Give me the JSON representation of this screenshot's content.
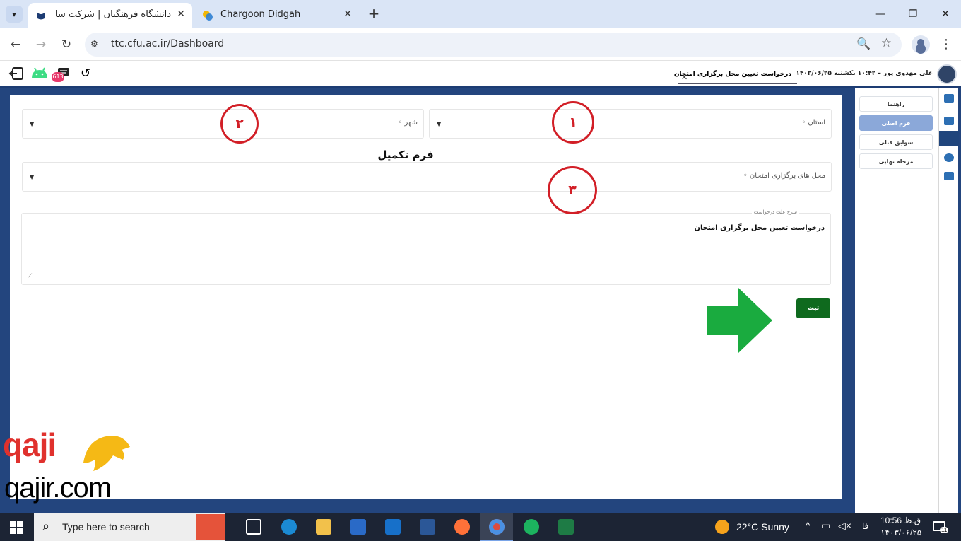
{
  "browser": {
    "tabs": [
      {
        "title": "دانشگاه فرهنگیان | شرکت سامانه",
        "active": true
      },
      {
        "title": "Chargoon Didgah",
        "active": false
      }
    ],
    "url": "ttc.cfu.ac.ir/Dashboard",
    "new_tab_symbol": "+"
  },
  "app": {
    "header": {
      "user_info": "علی مهدوی پور – ۱۰:۴۲ یکشنبه ۱۴۰۳/۰۶/۲۵",
      "open_tab": "درخواست تعیین محل برگزاری امتحان",
      "notification_count": "613"
    },
    "nav": {
      "items": [
        "راهنما",
        "فرم اصلی",
        "سوابق قبلی",
        "مرحله نهایی"
      ],
      "active_index": 1
    },
    "form": {
      "province_label": "استان ◦",
      "city_label": "شهر ◦",
      "title": "فرم تکمیل شود",
      "exam_location_label": "محل های برگزاری امتحان ◦",
      "request_reason_legend": "شرح علت درخواست",
      "request_reason_value": "درخواست تعیین محل برگزاری امتحان",
      "submit_label": "ثبت"
    },
    "annotations": [
      "۱",
      "۲",
      "۳"
    ]
  },
  "watermark": {
    "brand": "qaji",
    "url": "qajir.com"
  },
  "taskbar": {
    "search_placeholder": "Type here to search",
    "weather": "22°C  Sunny",
    "language": "فا",
    "time": "10:56 ق.ظ",
    "date": "۱۴۰۳/۰۶/۲۵",
    "notification_count": "11"
  },
  "colors": {
    "app_navy": "#23457e",
    "nav_active": "#8ba8d9",
    "submit_green": "#0f6a1e",
    "annotation_red": "#d21f27",
    "arrow_green": "#1aab3f"
  }
}
